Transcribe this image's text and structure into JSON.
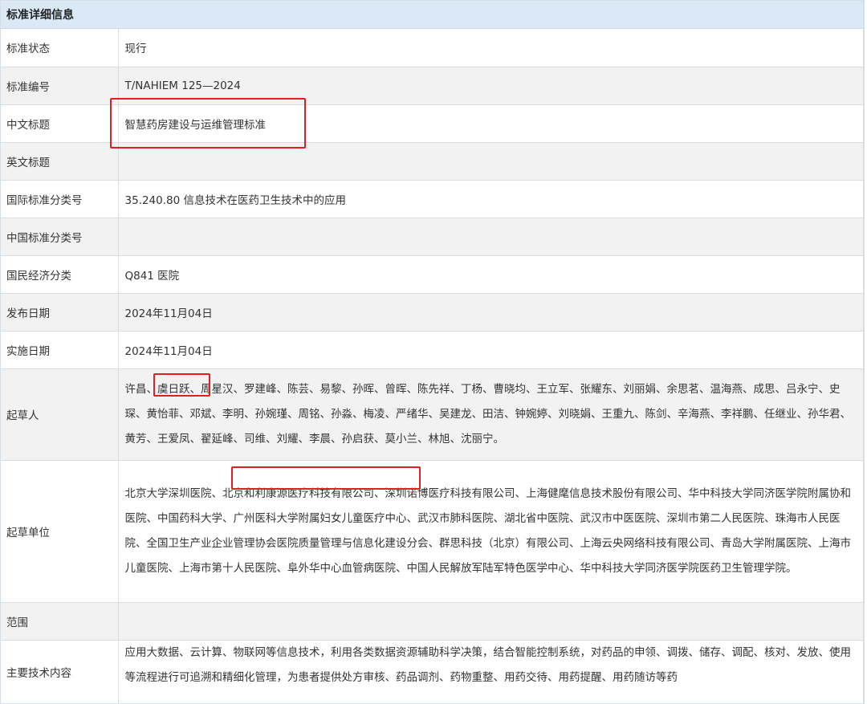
{
  "header": {
    "title": "标准详细信息"
  },
  "rows": [
    {
      "label": "标准状态",
      "value": "现行"
    },
    {
      "label": "标准编号",
      "value": "T/NAHIEM 125—2024"
    },
    {
      "label": "中文标题",
      "value": "智慧药房建设与运维管理标准"
    },
    {
      "label": "英文标题",
      "value": ""
    },
    {
      "label": "国际标准分类号",
      "value": "35.240.80 信息技术在医药卫生技术中的应用"
    },
    {
      "label": "中国标准分类号",
      "value": ""
    },
    {
      "label": "国民经济分类",
      "value": "Q841 医院"
    },
    {
      "label": "发布日期",
      "value": "2024年11月04日"
    },
    {
      "label": "实施日期",
      "value": "2024年11月04日"
    },
    {
      "label": "起草人",
      "value": "许昌、虞日跃、周星汉、罗建峰、陈芸、易黎、孙晖、曾晖、陈先祥、丁杨、曹晓均、王立军、张耀东、刘丽娟、余思茗、温海燕、成思、吕永宁、史琛、黄怡菲、邓斌、李明、孙婉瑾、周铭、孙淼、梅凌、严绪华、吴建龙、田洁、钟婉婷、刘晓娟、王重九、陈剑、辛海燕、李祥鹏、任继业、孙华君、黄芳、王爱凤、翟延峰、司维、刘耀、李晨、孙启获、莫小兰、林旭、沈丽宁。"
    },
    {
      "label": "起草单位",
      "value": "北京大学深圳医院、北京和利康源医疗科技有限公司、深圳诺博医疗科技有限公司、上海健麾信息技术股份有限公司、华中科技大学同济医学院附属协和医院、中国药科大学、广州医科大学附属妇女儿童医疗中心、武汉市肺科医院、湖北省中医院、武汉市中医医院、深圳市第二人民医院、珠海市人民医院、全国卫生产业企业管理协会医院质量管理与信息化建设分会、群思科技（北京）有限公司、上海云央网络科技有限公司、青岛大学附属医院、上海市儿童医院、上海市第十人民医院、阜外华中心血管病医院、中国人民解放军陆军特色医学中心、华中科技大学同济医学院医药卫生管理学院。"
    },
    {
      "label": "范围",
      "value": ""
    },
    {
      "label": "主要技术内容",
      "value": "应用大数据、云计算、物联网等信息技术，利用各类数据资源辅助科学决策，结合智能控制系统，对药品的申领、调拨、储存、调配、核对、发放、使用等流程进行可追溯和精细化管理，为患者提供处方审核、药品调剂、药物重整、用药交待、用药提醒、用药随访等药"
    }
  ]
}
